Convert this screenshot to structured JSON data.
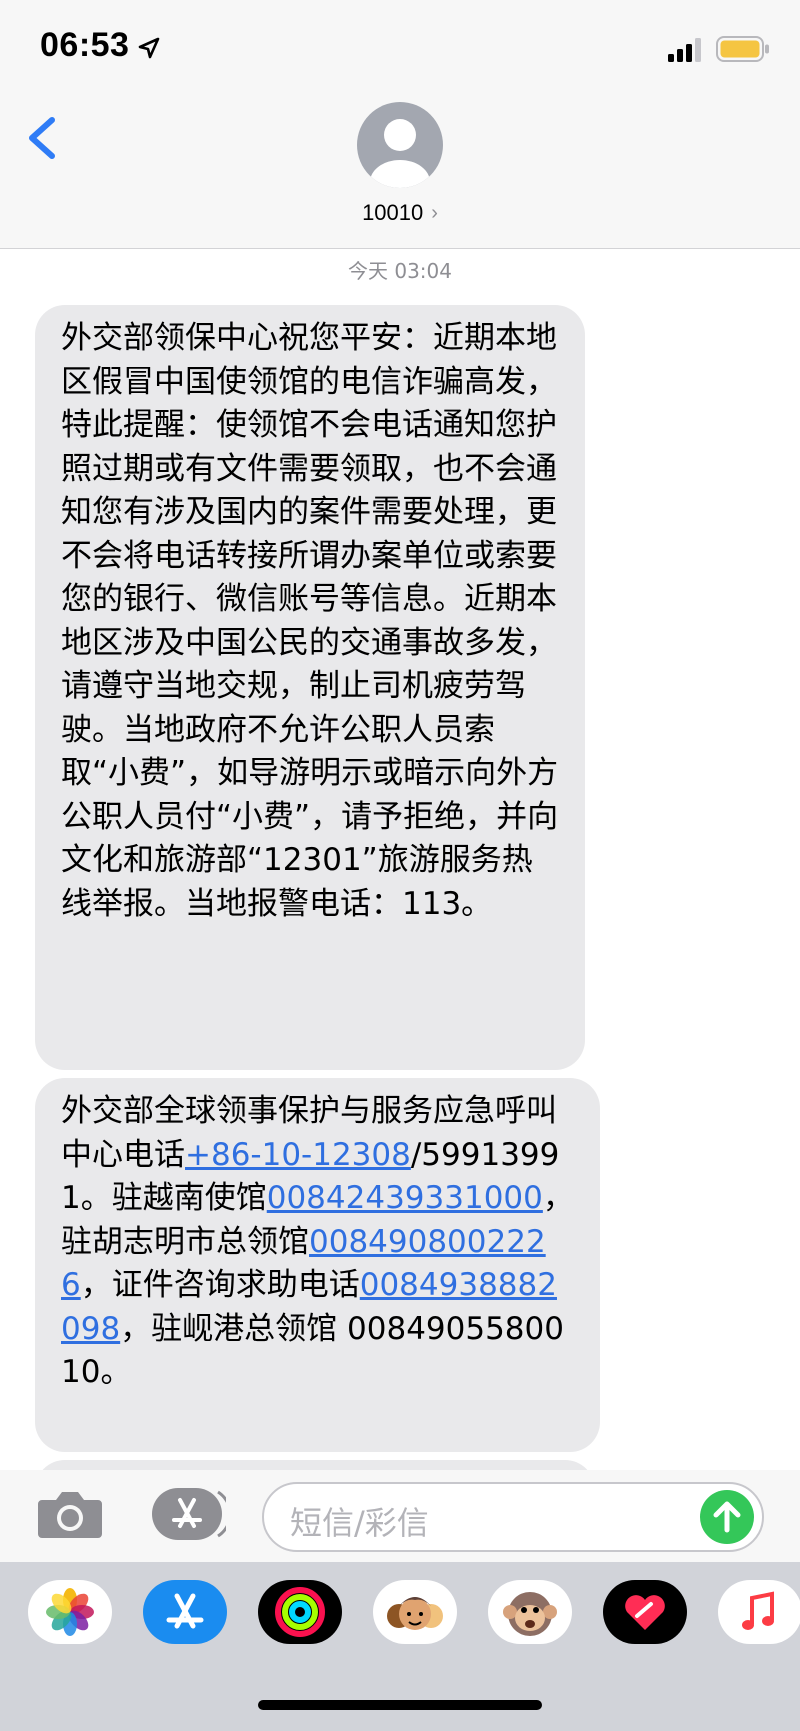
{
  "status_bar": {
    "time": "06:53"
  },
  "header": {
    "contact_name": "10010"
  },
  "thread": {
    "timestamp": "今天 03:04",
    "messages": [
      {
        "text": "外交部领保中心祝您平安：近期本地区假冒中国使领馆的电信诈骗高发，特此提醒：使领馆不会电话通知您护照过期或有文件需要领取，也不会通知您有涉及国内的案件需要处理，更不会将电话转接所谓办案单位或索要您的银行、微信账号等信息。近期本地区涉及中国公民的交通事故多发，请遵守当地交规，制止司机疲劳驾驶。当地政府不允许公职人员索取“小费”，如导游明示或暗示向外方公职人员付“小费”，请予拒绝，并向文化和旅游部“12301”旅游服务热线举报。当地报警电话：113。"
      },
      {
        "part1": "外交部全球领事保护与服务应急呼叫中心电话",
        "link1": "+86-10-12308",
        "part2": "/59913991。驻越南使馆",
        "link2": "00842439331000",
        "part3": "，驻胡志明市总领馆",
        "link3": "0084908002226",
        "part4": "，证件咨询求助电话",
        "link4": "0084938882098",
        "part5": "，驻岘港总领馆 0084905580010。"
      }
    ]
  },
  "input": {
    "placeholder": "短信/彩信"
  },
  "colors": {
    "bubble": "#e9e9eb",
    "link": "#2f6fe0",
    "send": "#34c759",
    "back": "#2f7cf6"
  },
  "icons": {
    "back": "chevron-left-icon",
    "camera": "camera-icon",
    "apps": "app-store-icon",
    "send": "arrow-up-icon",
    "drawer": [
      "photos-app-icon",
      "app-store-app-icon",
      "activity-app-icon",
      "memoji-app-icon",
      "animoji-app-icon",
      "digital-touch-app-icon",
      "music-app-icon"
    ]
  }
}
